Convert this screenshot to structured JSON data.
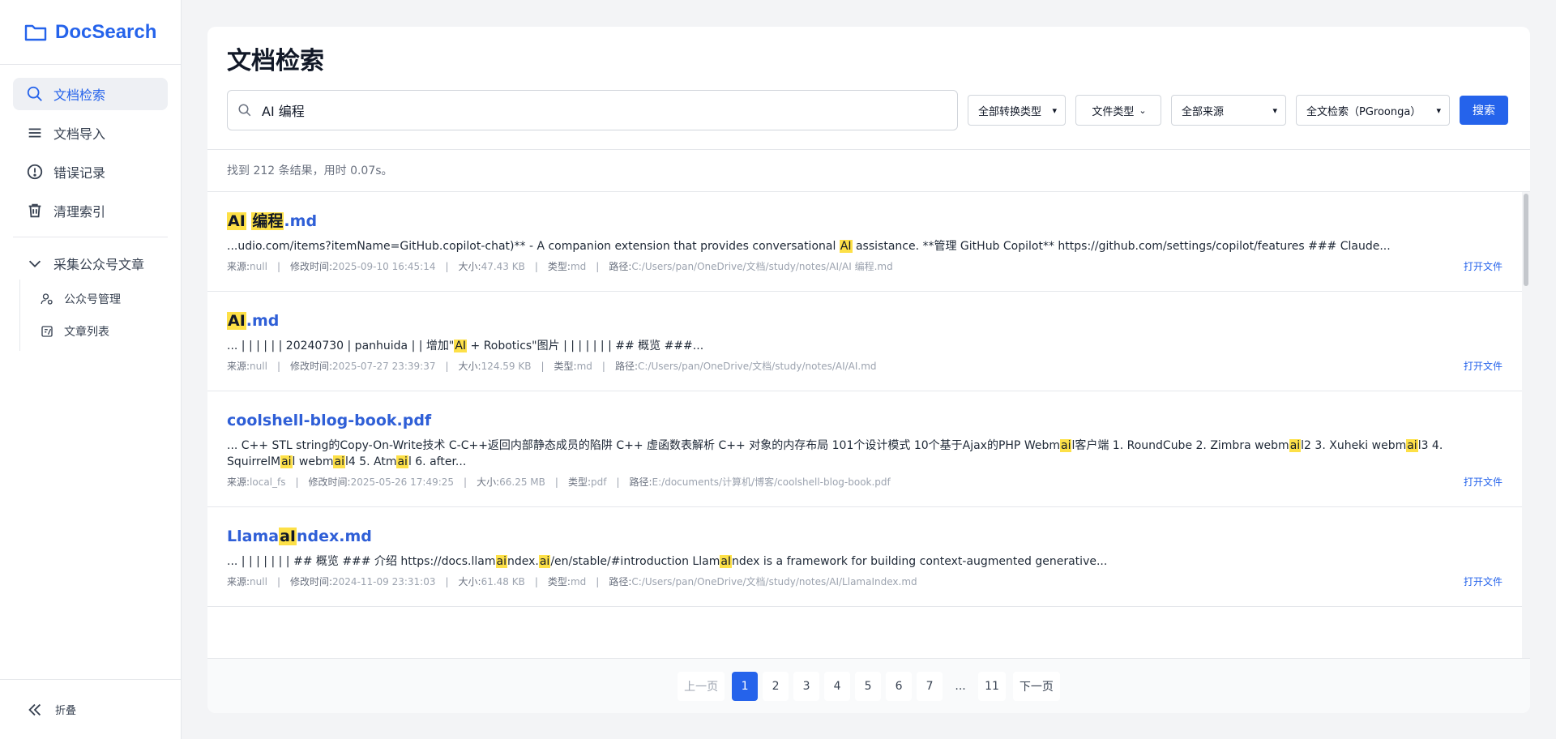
{
  "app": {
    "name": "DocSearch"
  },
  "sidebar": {
    "items": [
      {
        "label": "文档检索",
        "icon": "search-icon"
      },
      {
        "label": "文档导入",
        "icon": "menu-icon"
      },
      {
        "label": "错误记录",
        "icon": "alert-icon"
      },
      {
        "label": "清理索引",
        "icon": "trash-icon"
      }
    ],
    "group": {
      "label": "采集公众号文章",
      "items": [
        {
          "label": "公众号管理",
          "icon": "user-manage-icon"
        },
        {
          "label": "文章列表",
          "icon": "article-list-icon"
        }
      ]
    },
    "collapse_label": "折叠"
  },
  "main": {
    "title": "文档检索",
    "search_value": "AI 编程",
    "filters": {
      "conversion": "全部转换类型",
      "file_type": "文件类型",
      "source": "全部来源",
      "mode": "全文检索（PGroonga）"
    },
    "search_button": "搜索",
    "summary": "找到 212 条结果，用时 0.07s。"
  },
  "labels": {
    "source": "来源: ",
    "modified": "修改时间: ",
    "size": "大小: ",
    "type": "类型: ",
    "path": "路径: ",
    "open": "打开文件"
  },
  "results": [
    {
      "title": [
        {
          "t": "AI",
          "h": true
        },
        {
          "t": " ",
          "h": false
        },
        {
          "t": "编程",
          "h": true
        },
        {
          "t": ".md",
          "h": false
        }
      ],
      "snippet": [
        {
          "t": "...udio.com/items?itemName=GitHub.copilot-chat)** - A companion extension that provides conversational ",
          "h": false
        },
        {
          "t": "AI",
          "h": true
        },
        {
          "t": " assistance. **管理 GitHub Copilot** https://github.com/settings/copilot/features ### Claude...",
          "h": false
        }
      ],
      "source": "null",
      "modified": "2025-09-10 16:45:14",
      "size": "47.43 KB",
      "type": "md",
      "path": "C:/Users/pan/OneDrive/文档/study/notes/AI/AI 编程.md"
    },
    {
      "title": [
        {
          "t": "AI",
          "h": true
        },
        {
          "t": ".md",
          "h": false
        }
      ],
      "snippet": [
        {
          "t": "... | | | | | | 20240730 | panhuida | | 增加\"",
          "h": false
        },
        {
          "t": "AI",
          "h": true
        },
        {
          "t": " + Robotics\"图片 | | | | | | | ## 概览 ###...",
          "h": false
        }
      ],
      "source": "null",
      "modified": "2025-07-27 23:39:37",
      "size": "124.59 KB",
      "type": "md",
      "path": "C:/Users/pan/OneDrive/文档/study/notes/AI/AI.md"
    },
    {
      "title": [
        {
          "t": "coolshell-blog-book.pdf",
          "h": false
        }
      ],
      "snippet": [
        {
          "t": "... C++ STL string的Copy-On-Write技术 C-C++返回内部静态成员的陷阱 C++ 虚函数表解析 C++ 对象的内存布局 101个设计模式 10个基于Ajax的PHP Webm",
          "h": false
        },
        {
          "t": "ai",
          "h": true
        },
        {
          "t": "l客户端 1. RoundCube 2. Zimbra webm",
          "h": false
        },
        {
          "t": "ai",
          "h": true
        },
        {
          "t": "l2 3. Xuheki webm",
          "h": false
        },
        {
          "t": "ai",
          "h": true
        },
        {
          "t": "l3 4. SquirrelM",
          "h": false
        },
        {
          "t": "ai",
          "h": true
        },
        {
          "t": "l webm",
          "h": false
        },
        {
          "t": "ai",
          "h": true
        },
        {
          "t": "l4 5. Atm",
          "h": false
        },
        {
          "t": "ai",
          "h": true
        },
        {
          "t": "l 6. after...",
          "h": false
        }
      ],
      "source": "local_fs",
      "modified": "2025-05-26 17:49:25",
      "size": "66.25 MB",
      "type": "pdf",
      "path": "E:/documents/计算机/博客/coolshell-blog-book.pdf"
    },
    {
      "title": [
        {
          "t": "Llama",
          "h": false
        },
        {
          "t": "aI",
          "h": true
        },
        {
          "t": "ndex.md",
          "h": false
        }
      ],
      "snippet": [
        {
          "t": "... | | | | | | | ## 概览 ### 介绍 https://docs.llam",
          "h": false
        },
        {
          "t": "ai",
          "h": true
        },
        {
          "t": "ndex.",
          "h": false
        },
        {
          "t": "ai",
          "h": true
        },
        {
          "t": "/en/stable/#introduction Llam",
          "h": false
        },
        {
          "t": "aI",
          "h": true
        },
        {
          "t": "ndex is a framework for building context-augmented generative...",
          "h": false
        }
      ],
      "source": "null",
      "modified": "2024-11-09 23:31:03",
      "size": "61.48 KB",
      "type": "md",
      "path": "C:/Users/pan/OneDrive/文档/study/notes/AI/LlamaIndex.md"
    }
  ],
  "pagination": {
    "prev": "上一页",
    "next": "下一页",
    "pages": [
      "1",
      "2",
      "3",
      "4",
      "5",
      "6",
      "7",
      "...",
      "11"
    ],
    "current": "1"
  },
  "colors": {
    "accent": "#2563eb",
    "highlight": "#fde047",
    "link": "#2f5fd7"
  }
}
